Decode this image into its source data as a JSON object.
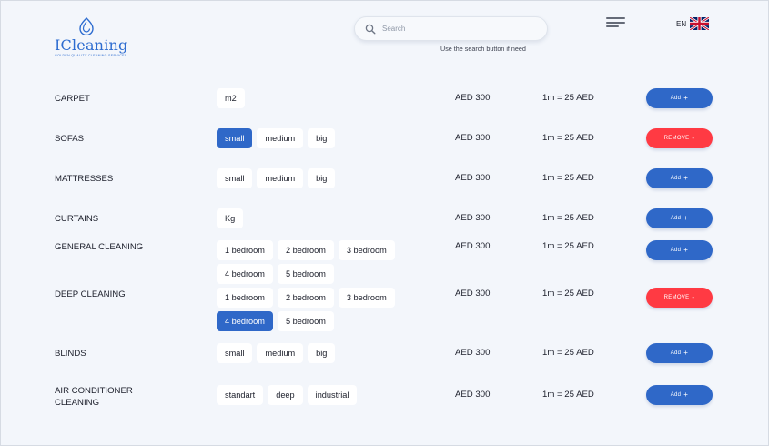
{
  "brand": {
    "name": "ICleaning",
    "tagline": "GOLDEN QUALITY CLEANING SERVICES",
    "color": "#2d6cd0"
  },
  "search": {
    "placeholder": "Search",
    "hint": "Use the search button if need"
  },
  "header": {
    "menu_icon": "hamburger-menu-icon",
    "language_code": "EN",
    "flag_icon": "uk-flag-icon"
  },
  "colors": {
    "accent_blue": "#2f68c8",
    "remove_red": "#ff3a43",
    "background": "#f3f6fb"
  },
  "services": [
    {
      "name": "CARPET",
      "options": [
        {
          "label": "m2",
          "selected": false
        }
      ],
      "price": "AED 300",
      "rate": "1m = 25 AED",
      "action": {
        "label": "Add",
        "symbol": "+",
        "type": "add"
      }
    },
    {
      "name": "SOFAS",
      "options": [
        {
          "label": "small",
          "selected": true
        },
        {
          "label": "medium",
          "selected": false
        },
        {
          "label": "big",
          "selected": false
        }
      ],
      "price": "AED 300",
      "rate": "1m = 25 AED",
      "action": {
        "label": "REMOVE",
        "symbol": "-",
        "type": "remove"
      }
    },
    {
      "name": "MATTRESSES",
      "options": [
        {
          "label": "small",
          "selected": false
        },
        {
          "label": "medium",
          "selected": false
        },
        {
          "label": "big",
          "selected": false
        }
      ],
      "price": "AED 300",
      "rate": "1m = 25 AED",
      "action": {
        "label": "Add",
        "symbol": "+",
        "type": "add"
      }
    },
    {
      "name": "CURTAINS",
      "options": [
        {
          "label": "Kg",
          "selected": false
        }
      ],
      "price": "AED 300",
      "rate": "1m = 25 AED",
      "action": {
        "label": "Add",
        "symbol": "+",
        "type": "add"
      }
    },
    {
      "name": "GENERAL CLEANING",
      "options": [
        {
          "label": "1 bedroom",
          "selected": false
        },
        {
          "label": "2 bedroom",
          "selected": false
        },
        {
          "label": "3 bedroom",
          "selected": false
        },
        {
          "label": "4 bedroom",
          "selected": false
        },
        {
          "label": "5 bedroom",
          "selected": false
        }
      ],
      "price": "AED 300",
      "rate": "1m = 25 AED",
      "action": {
        "label": "Add",
        "symbol": "+",
        "type": "add"
      }
    },
    {
      "name": "DEEP CLEANING",
      "options": [
        {
          "label": "1 bedroom",
          "selected": false
        },
        {
          "label": "2 bedroom",
          "selected": false
        },
        {
          "label": "3 bedroom",
          "selected": false
        },
        {
          "label": "4 bedroom",
          "selected": true
        },
        {
          "label": "5 bedroom",
          "selected": false
        }
      ],
      "price": "AED 300",
      "rate": "1m = 25 AED",
      "action": {
        "label": "REMOVE",
        "symbol": "-",
        "type": "remove"
      }
    },
    {
      "name": "BLINDS",
      "options": [
        {
          "label": "small",
          "selected": false
        },
        {
          "label": "medium",
          "selected": false
        },
        {
          "label": "big",
          "selected": false
        }
      ],
      "price": "AED 300",
      "rate": "1m = 25 AED",
      "action": {
        "label": "Add",
        "symbol": "+",
        "type": "add"
      }
    },
    {
      "name": "AIR CONDITIONER\nCLEANING",
      "options": [
        {
          "label": "standart",
          "selected": false
        },
        {
          "label": "deep",
          "selected": false
        },
        {
          "label": "industrial",
          "selected": false
        }
      ],
      "price": "AED 300",
      "rate": "1m = 25 AED",
      "action": {
        "label": "Add",
        "symbol": "+",
        "type": "add"
      }
    }
  ]
}
